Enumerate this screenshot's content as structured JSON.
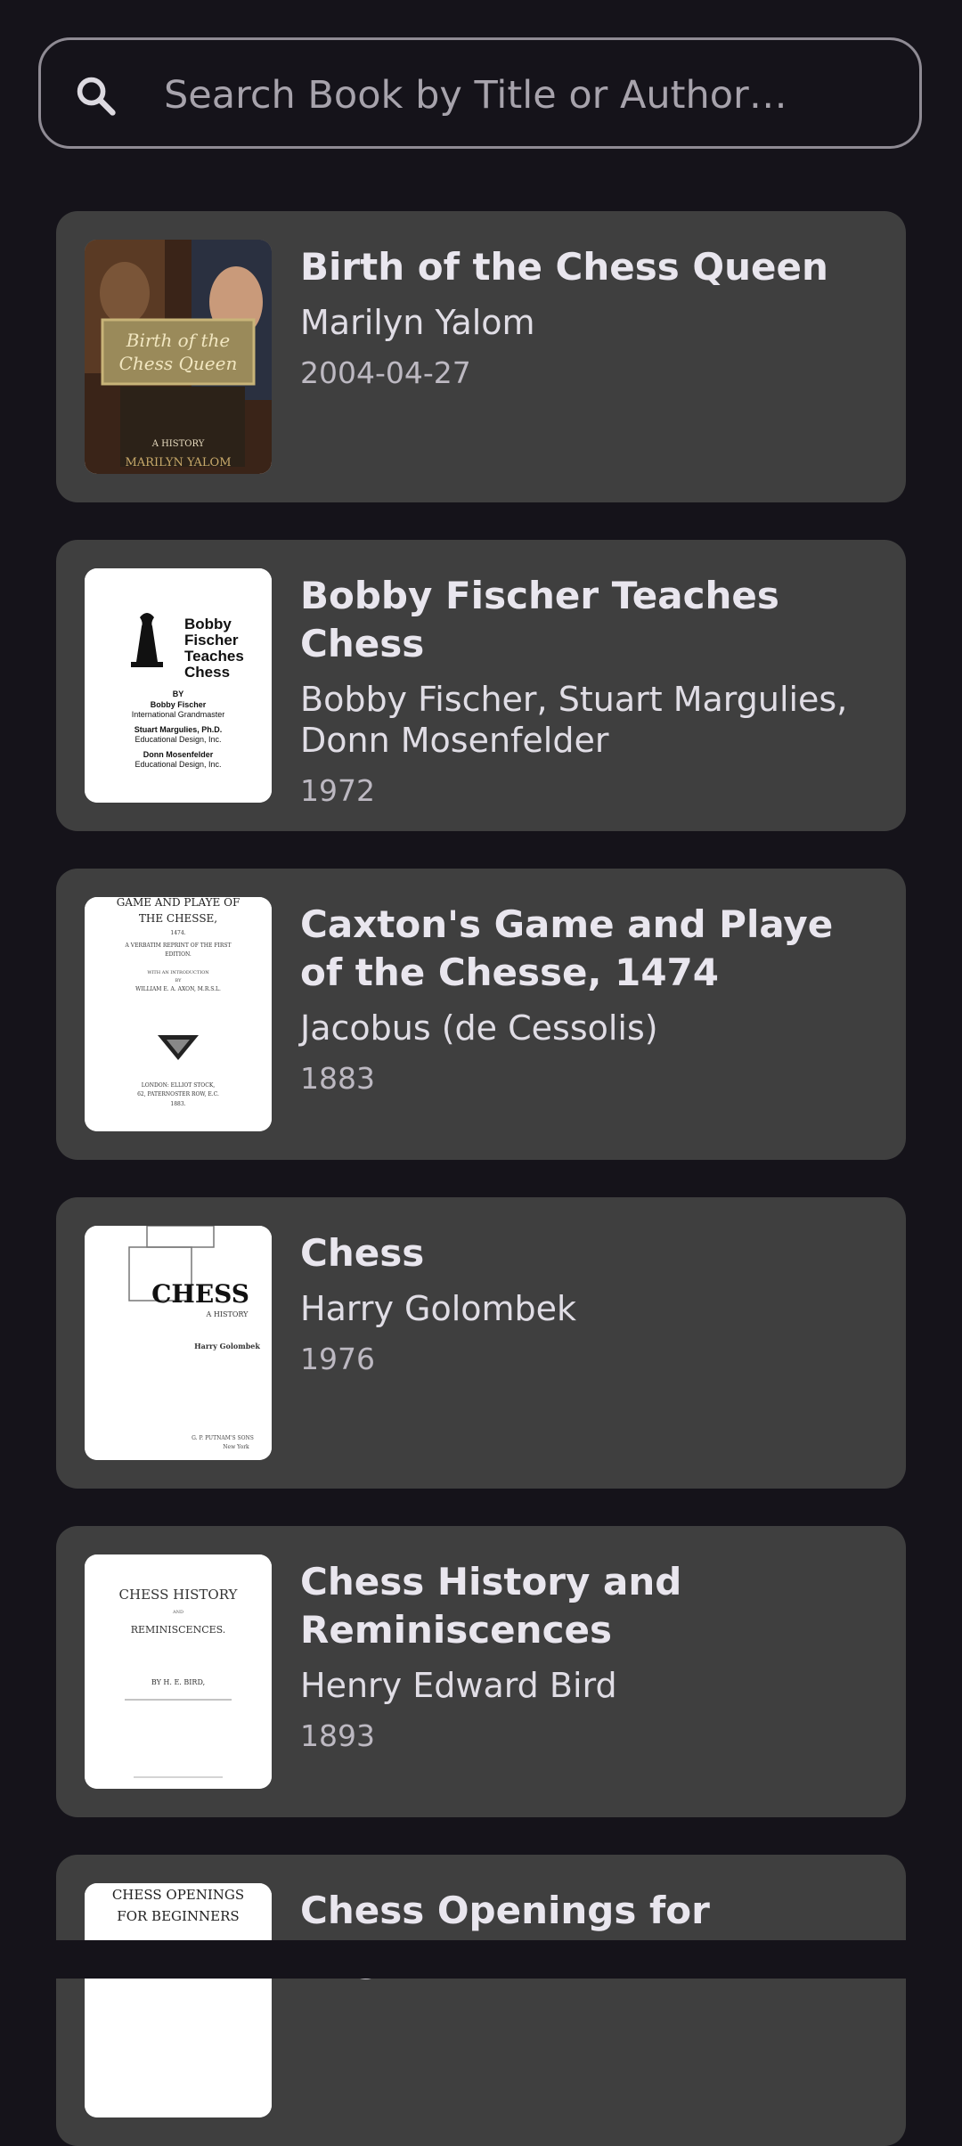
{
  "search": {
    "placeholder": "Search Book by Title or Author…",
    "value": ""
  },
  "books": [
    {
      "title": "Birth of the Chess Queen",
      "author": "Marilyn Yalom",
      "date": "2004-04-27",
      "cover_text": [
        "Birth of the",
        "Chess Queen",
        "A HISTORY",
        "MARILYN YALOM"
      ]
    },
    {
      "title": "Bobby Fischer Teaches Chess",
      "author": "Bobby Fischer, Stuart Margulies, Donn Mosenfelder",
      "date": "1972",
      "cover_text": [
        "Bobby",
        "Fischer",
        "Teaches",
        "Chess",
        "BY",
        "Bobby Fischer",
        "International Grandmaster",
        "Stuart Margulies, Ph.D.",
        "Educational Design, Inc.",
        "Donn Mosenfelder",
        "Educational Design, Inc."
      ]
    },
    {
      "title": "Caxton's Game and Playe of the Chesse, 1474",
      "author": "Jacobus (de Cessolis)",
      "date": "1883",
      "cover_text": [
        "GAME AND PLAYE OF",
        "THE CHESSE,",
        "1474.",
        "A VERBATIM REPRINT OF THE FIRST",
        "EDITION.",
        "WITH AN INTRODUCTION",
        "BY",
        "WILLIAM E. A. AXON, M.R.S.L.",
        "LONDON: ELLIOT STOCK,",
        "62, PATERNOSTER ROW, E.C.",
        "1883."
      ]
    },
    {
      "title": "Chess",
      "author": "Harry Golombek",
      "date": "1976",
      "cover_text": [
        "CHESS",
        "A HISTORY",
        "Harry Golombek",
        "G. P. PUTNAM'S SONS",
        "New York"
      ]
    },
    {
      "title": "Chess History and Reminiscences",
      "author": "Henry Edward Bird",
      "date": "1893",
      "cover_text": [
        "CHESS HISTORY",
        "AND",
        "REMINISCENCES.",
        "BY H. E. BIRD,"
      ]
    },
    {
      "title": "Chess Openings for Beginners",
      "author": "",
      "date": "",
      "cover_text": [
        "CHESS OPENINGS",
        "FOR BEGINNERS"
      ]
    }
  ]
}
